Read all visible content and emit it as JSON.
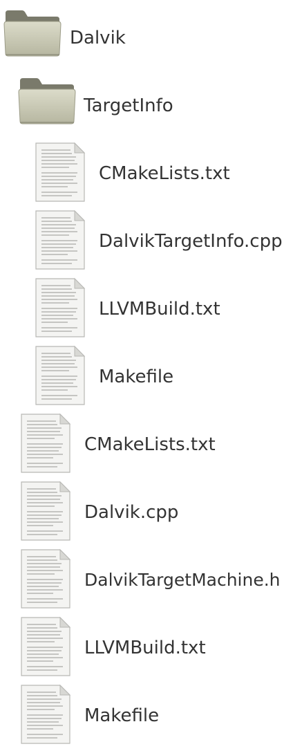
{
  "tree": {
    "items": [
      {
        "label": "Dalvik",
        "type": "folder",
        "depth": 0
      },
      {
        "label": "TargetInfo",
        "type": "folder",
        "depth": 1
      },
      {
        "label": "CMakeLists.txt",
        "type": "file",
        "depth": 2
      },
      {
        "label": "DalvikTargetInfo.cpp",
        "type": "file",
        "depth": 2
      },
      {
        "label": "LLVMBuild.txt",
        "type": "file",
        "depth": 2
      },
      {
        "label": "Makefile",
        "type": "file",
        "depth": 2
      },
      {
        "label": "CMakeLists.txt",
        "type": "file",
        "depth": 1
      },
      {
        "label": "Dalvik.cpp",
        "type": "file",
        "depth": 1
      },
      {
        "label": "DalvikTargetMachine.h",
        "type": "file",
        "depth": 1
      },
      {
        "label": "LLVMBuild.txt",
        "type": "file",
        "depth": 1
      },
      {
        "label": "Makefile",
        "type": "file",
        "depth": 1
      }
    ]
  },
  "colors": {
    "label_text": "#333333",
    "folder_body": "#c9c9b3",
    "folder_tab": "#7d7d6e",
    "file_paper": "#f4f4f2"
  }
}
